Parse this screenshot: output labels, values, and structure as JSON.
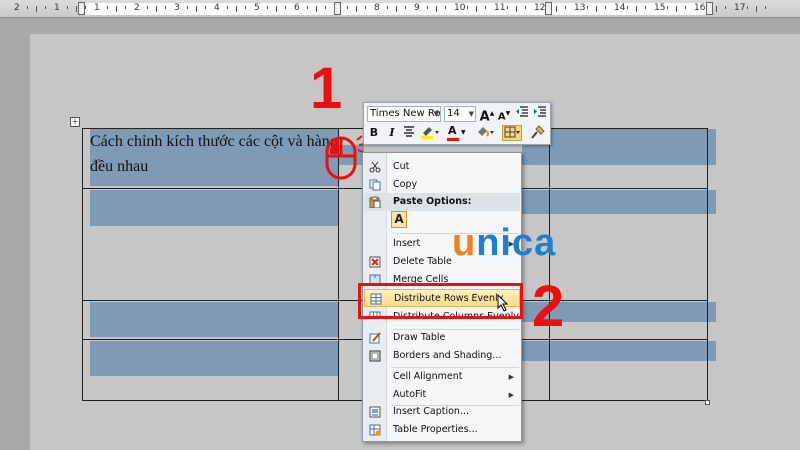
{
  "ruler": {
    "numbers": [
      "2",
      "1",
      "1",
      "2",
      "3",
      "4",
      "5",
      "6",
      "7",
      "8",
      "9",
      "10",
      "11",
      "12",
      "13",
      "14",
      "15",
      "16",
      "17"
    ]
  },
  "table": {
    "cell_text": "Cách chỉnh kích thước các cột và hàng đều nhau"
  },
  "mini_toolbar": {
    "font_name": "Times New Ron",
    "font_size": "14",
    "bold": "B",
    "italic": "I",
    "font_color_letter": "A",
    "grow_letter": "A",
    "shrink_letter": "A"
  },
  "context_menu": {
    "cut": "Cut",
    "copy": "Copy",
    "paste_options": "Paste Options:",
    "paste_keep": "A",
    "insert": "Insert",
    "delete_table": "Delete Table",
    "merge_cells": "Merge Cells",
    "distribute_rows": "Distribute Rows Evenly",
    "distribute_columns": "Distribute Columns Evenly",
    "draw_table": "Draw Table",
    "borders_shading": "Borders and Shading...",
    "cell_alignment": "Cell Alignment",
    "autofit": "AutoFit",
    "insert_caption": "Insert Caption...",
    "table_properties": "Table Properties..."
  },
  "annotations": {
    "step1": "1",
    "step2": "2",
    "logo_u": "u",
    "logo_rest": "nica"
  },
  "colors": {
    "annotation_red": "#e8110f",
    "table_selection": "#7f9ab5",
    "logo_orange": "#f57c1f",
    "logo_blue": "#1e7fd1",
    "menu_highlight": "#fbdc86"
  },
  "icons": [
    "scissors-icon",
    "copy-icon",
    "clipboard-icon",
    "delete-table-icon",
    "merge-cells-icon",
    "distribute-rows-icon",
    "distribute-columns-icon",
    "draw-table-icon",
    "borders-shading-icon",
    "caption-icon",
    "table-properties-icon",
    "mouse-icon",
    "pointer-cursor-icon"
  ]
}
